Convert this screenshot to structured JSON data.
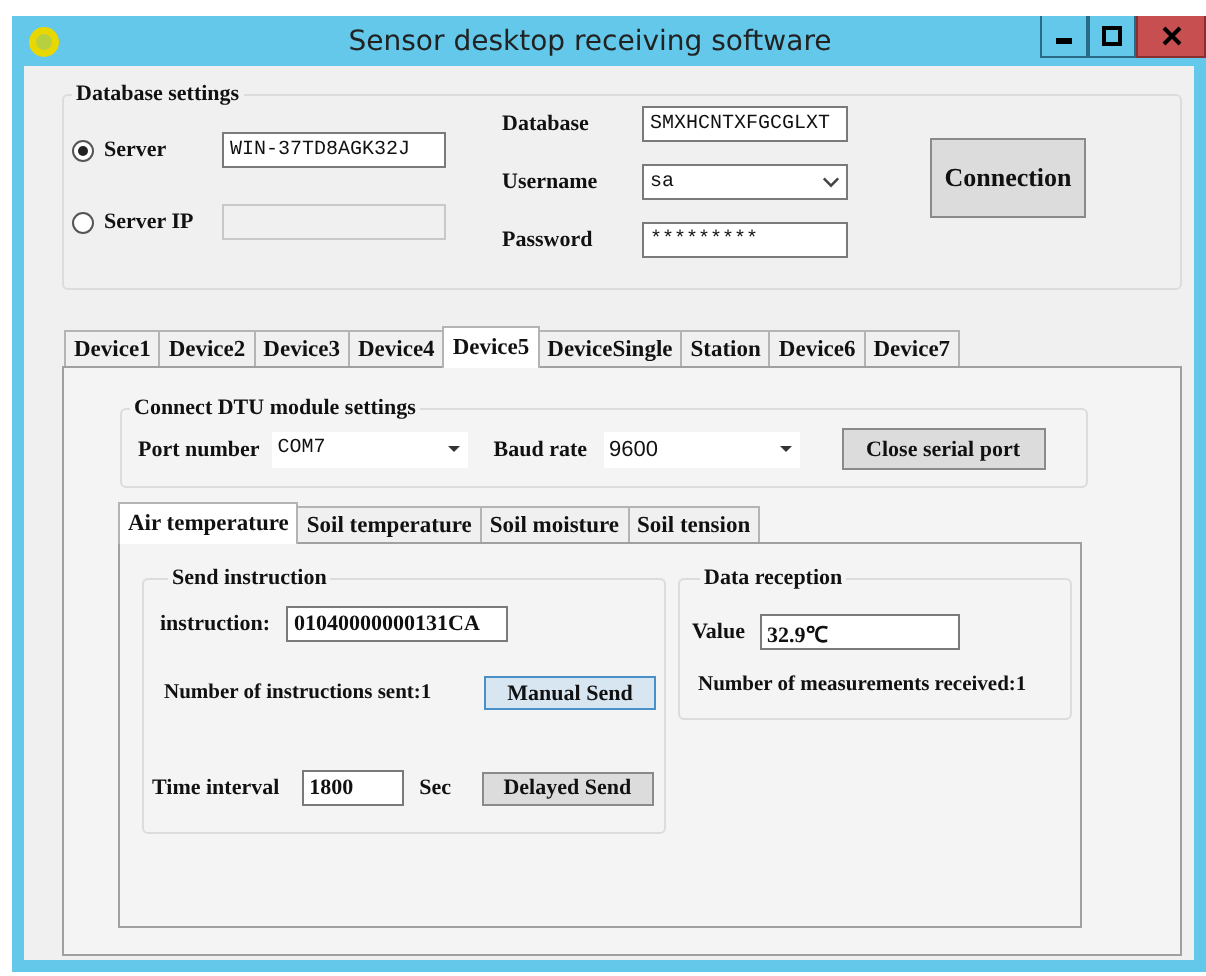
{
  "window": {
    "title": "Sensor desktop receiving software"
  },
  "database_settings": {
    "title": "Database settings",
    "server_options": [
      {
        "label": "Server",
        "selected": true,
        "disabled": false,
        "value": "WIN-37TD8AGK32J"
      },
      {
        "label": "Server IP",
        "selected": false,
        "disabled": true
      }
    ],
    "fields": [
      {
        "label": "Database",
        "value": "SMXHCNTXFGCGLXT",
        "kind": "text"
      },
      {
        "label": "Username",
        "value": "sa",
        "kind": "dropdown"
      },
      {
        "label": "Password",
        "value": "*********",
        "kind": "text"
      }
    ],
    "connect_button": "Connection"
  },
  "device_tabs": [
    {
      "label": "Device1",
      "selected": false
    },
    {
      "label": "Device2",
      "selected": false
    },
    {
      "label": "Device3",
      "selected": false
    },
    {
      "label": "Device4",
      "selected": false
    },
    {
      "label": "Device5",
      "selected": true
    },
    {
      "label": "DeviceSingle",
      "selected": false
    },
    {
      "label": "Station",
      "selected": false
    },
    {
      "label": "Device6",
      "selected": false
    },
    {
      "label": "Device7",
      "selected": false
    }
  ],
  "dtu_settings": {
    "title": "Connect DTU module settings",
    "port_label": "Port number",
    "port": "COM7",
    "baud_label": "Baud rate",
    "baud": "9600",
    "button": "Close serial port"
  },
  "sensor_tabs": [
    {
      "label": "Air temperature",
      "selected": true
    },
    {
      "label": "Soil temperature",
      "selected": false
    },
    {
      "label": "Soil moisture",
      "selected": false
    },
    {
      "label": "Soil tension",
      "selected": false
    }
  ],
  "send_instruction": {
    "title": "Send instruction",
    "instruction_label": "instruction:",
    "instruction": "01040000000131CA",
    "sent_count": "Number of instructions sent:1",
    "manual_button": "Manual Send",
    "interval_label": "Time interval",
    "interval": "1800",
    "unit": "Sec",
    "delayed_button": "Delayed Send"
  },
  "data_reception": {
    "title": "Data reception",
    "value_label": "Value",
    "value": "32.9℃",
    "received_count": "Number of measurements received:1"
  }
}
